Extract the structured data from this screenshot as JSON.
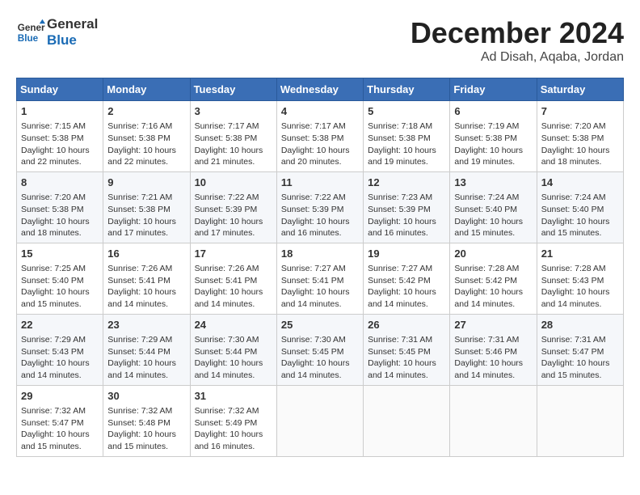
{
  "header": {
    "logo_line1": "General",
    "logo_line2": "Blue",
    "month": "December 2024",
    "location": "Ad Disah, Aqaba, Jordan"
  },
  "weekdays": [
    "Sunday",
    "Monday",
    "Tuesday",
    "Wednesday",
    "Thursday",
    "Friday",
    "Saturday"
  ],
  "weeks": [
    [
      {
        "day": "1",
        "text": "Sunrise: 7:15 AM\nSunset: 5:38 PM\nDaylight: 10 hours\nand 22 minutes."
      },
      {
        "day": "2",
        "text": "Sunrise: 7:16 AM\nSunset: 5:38 PM\nDaylight: 10 hours\nand 22 minutes."
      },
      {
        "day": "3",
        "text": "Sunrise: 7:17 AM\nSunset: 5:38 PM\nDaylight: 10 hours\nand 21 minutes."
      },
      {
        "day": "4",
        "text": "Sunrise: 7:17 AM\nSunset: 5:38 PM\nDaylight: 10 hours\nand 20 minutes."
      },
      {
        "day": "5",
        "text": "Sunrise: 7:18 AM\nSunset: 5:38 PM\nDaylight: 10 hours\nand 19 minutes."
      },
      {
        "day": "6",
        "text": "Sunrise: 7:19 AM\nSunset: 5:38 PM\nDaylight: 10 hours\nand 19 minutes."
      },
      {
        "day": "7",
        "text": "Sunrise: 7:20 AM\nSunset: 5:38 PM\nDaylight: 10 hours\nand 18 minutes."
      }
    ],
    [
      {
        "day": "8",
        "text": "Sunrise: 7:20 AM\nSunset: 5:38 PM\nDaylight: 10 hours\nand 18 minutes."
      },
      {
        "day": "9",
        "text": "Sunrise: 7:21 AM\nSunset: 5:38 PM\nDaylight: 10 hours\nand 17 minutes."
      },
      {
        "day": "10",
        "text": "Sunrise: 7:22 AM\nSunset: 5:39 PM\nDaylight: 10 hours\nand 17 minutes."
      },
      {
        "day": "11",
        "text": "Sunrise: 7:22 AM\nSunset: 5:39 PM\nDaylight: 10 hours\nand 16 minutes."
      },
      {
        "day": "12",
        "text": "Sunrise: 7:23 AM\nSunset: 5:39 PM\nDaylight: 10 hours\nand 16 minutes."
      },
      {
        "day": "13",
        "text": "Sunrise: 7:24 AM\nSunset: 5:40 PM\nDaylight: 10 hours\nand 15 minutes."
      },
      {
        "day": "14",
        "text": "Sunrise: 7:24 AM\nSunset: 5:40 PM\nDaylight: 10 hours\nand 15 minutes."
      }
    ],
    [
      {
        "day": "15",
        "text": "Sunrise: 7:25 AM\nSunset: 5:40 PM\nDaylight: 10 hours\nand 15 minutes."
      },
      {
        "day": "16",
        "text": "Sunrise: 7:26 AM\nSunset: 5:41 PM\nDaylight: 10 hours\nand 14 minutes."
      },
      {
        "day": "17",
        "text": "Sunrise: 7:26 AM\nSunset: 5:41 PM\nDaylight: 10 hours\nand 14 minutes."
      },
      {
        "day": "18",
        "text": "Sunrise: 7:27 AM\nSunset: 5:41 PM\nDaylight: 10 hours\nand 14 minutes."
      },
      {
        "day": "19",
        "text": "Sunrise: 7:27 AM\nSunset: 5:42 PM\nDaylight: 10 hours\nand 14 minutes."
      },
      {
        "day": "20",
        "text": "Sunrise: 7:28 AM\nSunset: 5:42 PM\nDaylight: 10 hours\nand 14 minutes."
      },
      {
        "day": "21",
        "text": "Sunrise: 7:28 AM\nSunset: 5:43 PM\nDaylight: 10 hours\nand 14 minutes."
      }
    ],
    [
      {
        "day": "22",
        "text": "Sunrise: 7:29 AM\nSunset: 5:43 PM\nDaylight: 10 hours\nand 14 minutes."
      },
      {
        "day": "23",
        "text": "Sunrise: 7:29 AM\nSunset: 5:44 PM\nDaylight: 10 hours\nand 14 minutes."
      },
      {
        "day": "24",
        "text": "Sunrise: 7:30 AM\nSunset: 5:44 PM\nDaylight: 10 hours\nand 14 minutes."
      },
      {
        "day": "25",
        "text": "Sunrise: 7:30 AM\nSunset: 5:45 PM\nDaylight: 10 hours\nand 14 minutes."
      },
      {
        "day": "26",
        "text": "Sunrise: 7:31 AM\nSunset: 5:45 PM\nDaylight: 10 hours\nand 14 minutes."
      },
      {
        "day": "27",
        "text": "Sunrise: 7:31 AM\nSunset: 5:46 PM\nDaylight: 10 hours\nand 14 minutes."
      },
      {
        "day": "28",
        "text": "Sunrise: 7:31 AM\nSunset: 5:47 PM\nDaylight: 10 hours\nand 15 minutes."
      }
    ],
    [
      {
        "day": "29",
        "text": "Sunrise: 7:32 AM\nSunset: 5:47 PM\nDaylight: 10 hours\nand 15 minutes."
      },
      {
        "day": "30",
        "text": "Sunrise: 7:32 AM\nSunset: 5:48 PM\nDaylight: 10 hours\nand 15 minutes."
      },
      {
        "day": "31",
        "text": "Sunrise: 7:32 AM\nSunset: 5:49 PM\nDaylight: 10 hours\nand 16 minutes."
      },
      {
        "day": "",
        "text": ""
      },
      {
        "day": "",
        "text": ""
      },
      {
        "day": "",
        "text": ""
      },
      {
        "day": "",
        "text": ""
      }
    ]
  ]
}
